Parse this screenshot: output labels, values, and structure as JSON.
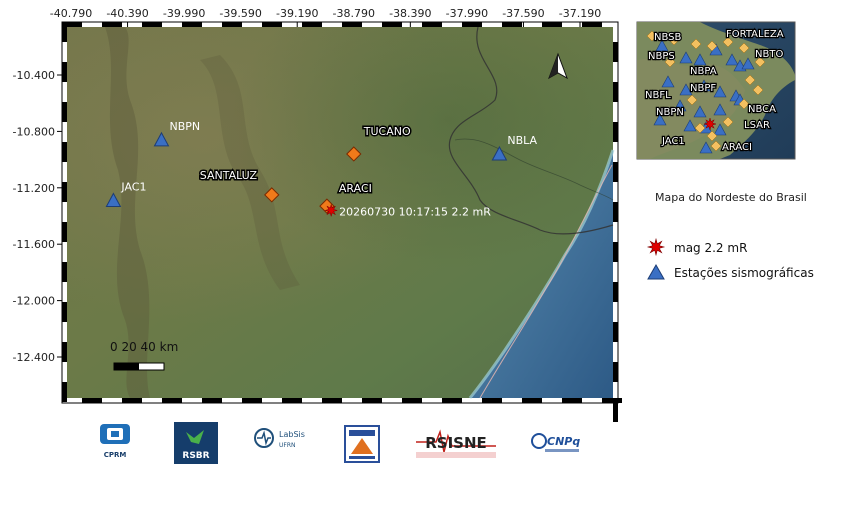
{
  "map": {
    "x_ticks": [
      "-40.790",
      "-40.390",
      "-39.990",
      "-39.590",
      "-39.190",
      "-38.790",
      "-38.390",
      "-37.990",
      "-37.590",
      "-37.190"
    ],
    "y_ticks": [
      "-10.400",
      "-10.800",
      "-11.200",
      "-11.600",
      "-12.000",
      "-12.400"
    ],
    "stations": [
      {
        "name": "NBPN",
        "lon": -40.15,
        "lat": -10.86
      },
      {
        "name": "JAC1",
        "lon": -40.49,
        "lat": -11.29
      },
      {
        "name": "NBLA",
        "lon": -37.76,
        "lat": -10.96
      }
    ],
    "cities": [
      {
        "name": "TUCANO",
        "lon": -38.79,
        "lat": -10.96
      },
      {
        "name": "SANTALUZ",
        "lon": -39.37,
        "lat": -11.25
      },
      {
        "name": "ARACI",
        "lon": -38.98,
        "lat": -11.33
      }
    ],
    "event": {
      "label": "20260730 10:17:15 2.2 mR",
      "lon": -38.95,
      "lat": -11.36
    },
    "scale_label": "0   20   40 km",
    "north_icon": "north-arrow-icon"
  },
  "inset": {
    "labels": [
      "NBSB",
      "FORTALEZA",
      "NBTO",
      "NBPS",
      "NBPA",
      "NBPF",
      "NBFL",
      "NBPN",
      "NBCA",
      "LSAR",
      "JAC1",
      "ARACI"
    ],
    "caption": "Mapa do Nordeste do Brasil"
  },
  "legend": {
    "items": [
      {
        "icon": "star-burst-icon",
        "label": "mag 2.2 mR",
        "color": "#e00000"
      },
      {
        "icon": "triangle-icon",
        "label": "Estações sismográficas",
        "color": "#3a6fc4"
      }
    ]
  },
  "logos": [
    "CPRM",
    "RSBR",
    "LabSis",
    "UFRN",
    "RSISNE",
    "CNPq"
  ],
  "colors": {
    "station": "#3a6fc4",
    "city": "#f07a1a",
    "ocean": "#3f6f9a",
    "land": "#6f7a4a"
  }
}
